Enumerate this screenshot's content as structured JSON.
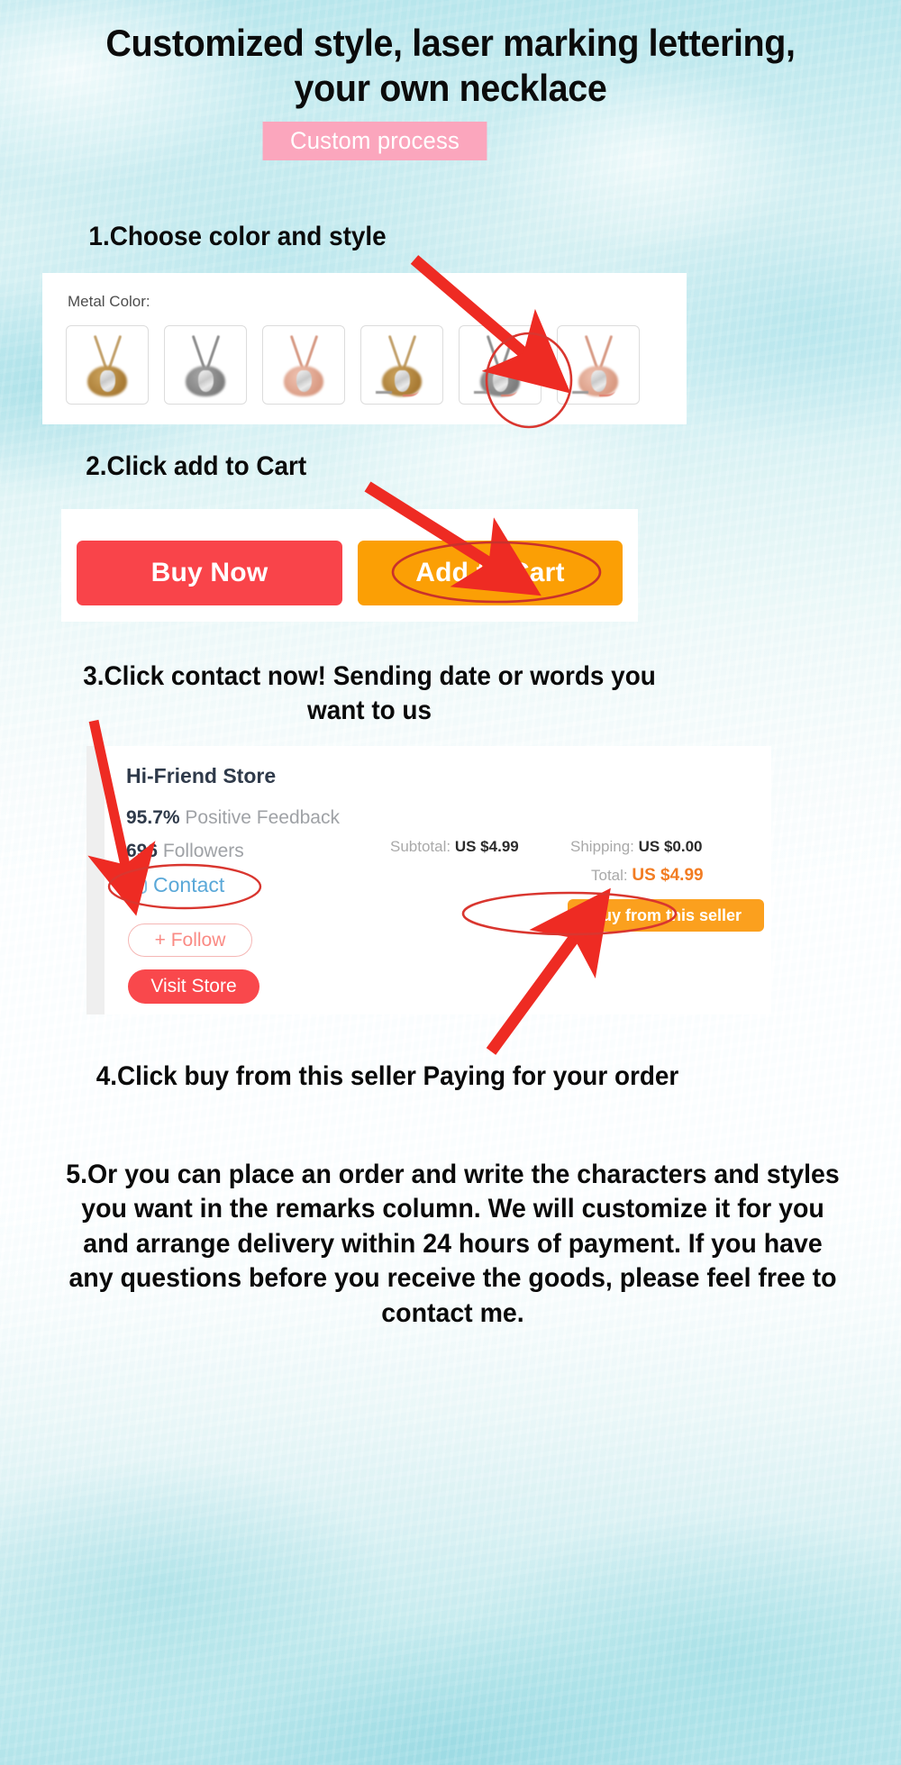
{
  "hero": {
    "title": "Customized style, laser marking lettering, your own necklace",
    "badge": "Custom process"
  },
  "steps": {
    "step1": "1.Choose color and style",
    "step2": "2.Click add to Cart",
    "step3": "3.Click contact now!   Sending date or words you want to us",
    "step4": "4.Click buy from this seller Paying for your order",
    "step5": "5.Or you can place an order and write the characters and styles you want in the remarks column. We will customize it for you and arrange delivery within 24 hours of payment. If you have any questions before you receive the goods, please feel free to contact me."
  },
  "product_options": {
    "label": "Metal Color:",
    "swatches": [
      {
        "name": "gold-necklace-swatch",
        "chain": "#c2a06a",
        "stone": "#b0853f",
        "selected": false,
        "has_tail": false
      },
      {
        "name": "silver-necklace-swatch",
        "chain": "#8c8c8c",
        "stone": "#8f8f8f",
        "selected": false,
        "has_tail": false
      },
      {
        "name": "rose-gold-necklace-swatch",
        "chain": "#d79a84",
        "stone": "#e0a994",
        "selected": false,
        "has_tail": false
      },
      {
        "name": "gold-engraved-necklace-swatch",
        "chain": "#c2a06a",
        "stone": "#b0853f",
        "selected": false,
        "has_tail": true
      },
      {
        "name": "silver-engraved-necklace-swatch",
        "chain": "#8c8c8c",
        "stone": "#8f8f8f",
        "selected": true,
        "has_tail": true
      },
      {
        "name": "rose-gold-engraved-necklace-swatch",
        "chain": "#d79a84",
        "stone": "#e0a994",
        "selected": false,
        "has_tail": true
      }
    ]
  },
  "actions": {
    "buy_now": "Buy Now",
    "add_to_cart": "Add to Cart"
  },
  "store": {
    "name": "Hi-Friend Store",
    "feedback_value": "95.7%",
    "feedback_label": "Positive Feedback",
    "followers_value": "696",
    "followers_label": "Followers",
    "contact": "Contact",
    "follow": "+ Follow",
    "visit_store": "Visit Store"
  },
  "order_summary": {
    "subtotal_label": "Subtotal:",
    "subtotal_value": "US $4.99",
    "shipping_label": "Shipping:",
    "shipping_value": "US $0.00",
    "total_label": "Total:",
    "total_value": "US $4.99",
    "buy_from_seller": "Buy from this seller"
  },
  "colors": {
    "buy_now": "#f9444a",
    "add_to_cart": "#fb9f05",
    "badge_pink": "#fba6bd",
    "annotation_red": "#ee2b23",
    "highlight_circle": "#d9362f",
    "total_orange": "#f27c22",
    "contact_blue": "#5aa8d8",
    "visit_store_red": "#f9484c",
    "buy_seller_orange": "#fba01e",
    "background_teal": "#c0e9ee"
  },
  "annotations": {
    "arrow_to_swatch": "red-arrow-pointing-to-selected-metal-swatch",
    "circle_swatch": "red-ellipse-highlighting-selected-swatch",
    "arrow_to_add_cart": "red-arrow-pointing-to-add-to-cart-button",
    "circle_add_cart": "red-ellipse-highlighting-add-to-cart-button",
    "arrow_to_contact": "red-arrow-pointing-to-contact-link",
    "circle_contact": "red-ellipse-highlighting-contact-link",
    "arrow_to_buy_seller": "red-arrow-pointing-to-buy-from-this-seller-button",
    "circle_buy_seller": "red-ellipse-highlighting-buy-from-this-seller-button"
  }
}
